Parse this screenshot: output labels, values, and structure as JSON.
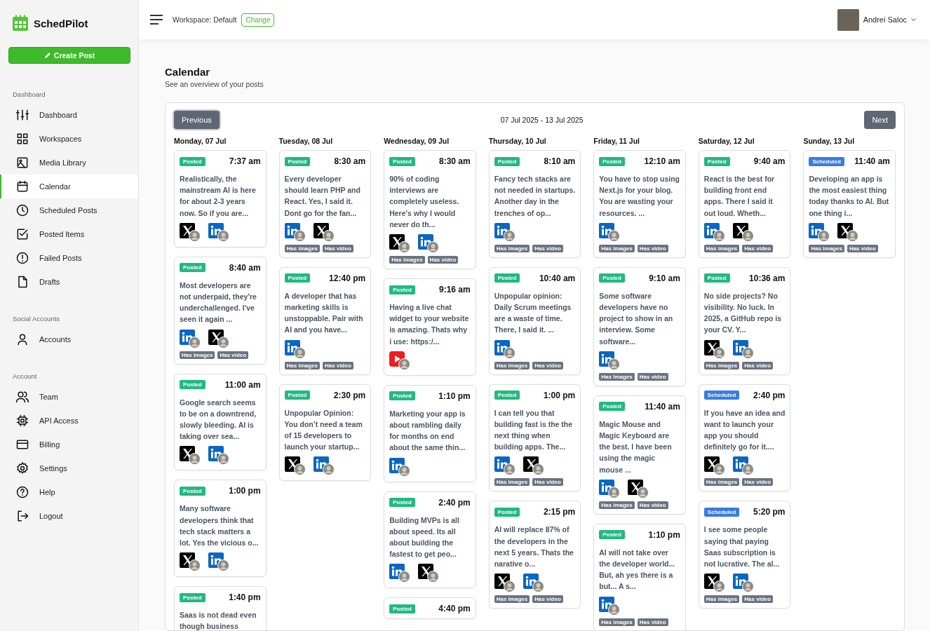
{
  "app": {
    "name": "SchedPilot"
  },
  "create_button": {
    "label": "Create Post"
  },
  "sidebar": {
    "sections": [
      {
        "title": "Dashboard",
        "items": [
          {
            "label": "Dashboard",
            "kind": "sliders",
            "selected": false
          },
          {
            "label": "Workspaces",
            "kind": "grid",
            "selected": false
          },
          {
            "label": "Media Library",
            "kind": "image",
            "selected": false
          },
          {
            "label": "Calendar",
            "kind": "calendar",
            "selected": true
          },
          {
            "label": "Scheduled Posts",
            "kind": "clock",
            "selected": false
          },
          {
            "label": "Posted Items",
            "kind": "checkbox",
            "selected": false
          },
          {
            "label": "Failed Posts",
            "kind": "alert",
            "selected": false
          },
          {
            "label": "Drafts",
            "kind": "file",
            "selected": false
          }
        ]
      },
      {
        "title": "Social Accounts",
        "items": [
          {
            "label": "Accounts",
            "kind": "user",
            "selected": false
          }
        ]
      },
      {
        "title": "Account",
        "items": [
          {
            "label": "Team",
            "kind": "users",
            "selected": false
          },
          {
            "label": "API Access",
            "kind": "chip",
            "selected": false
          },
          {
            "label": "Billing",
            "kind": "card",
            "selected": false
          },
          {
            "label": "Settings",
            "kind": "gear",
            "selected": false
          },
          {
            "label": "Help",
            "kind": "help",
            "selected": false
          },
          {
            "label": "Logout",
            "kind": "logout",
            "selected": false
          }
        ]
      }
    ]
  },
  "header": {
    "workspace": "Workspace: Default",
    "change_button": "Change",
    "user_name": "Andrei Saloc"
  },
  "page": {
    "title": "Calendar",
    "subtitle": "See an overview of your posts"
  },
  "calendar": {
    "previous": "Previous",
    "range": "07 Jul 2025 - 13 Jul 2025",
    "next": "Next",
    "days": [
      {
        "label": "Monday, 07 Jul",
        "posts": [
          {
            "status": {
              "label": "Posted",
              "kind": "posted"
            },
            "time": "7:37 am",
            "text": "Realistically, the mainstream AI is here for about 2-3 years now. So if you are...",
            "platforms": [
              {
                "kind": "x"
              },
              {
                "kind": "linkedin"
              }
            ]
          },
          {
            "status": {
              "label": "Posted",
              "kind": "posted"
            },
            "time": "8:40 am",
            "text": "Most developers are not underpaid, they're underchallenged. I've seen it again ...",
            "platforms": [
              {
                "kind": "linkedin"
              },
              {
                "kind": "x"
              }
            ],
            "tags": [
              "Has images",
              "Has video"
            ]
          },
          {
            "status": {
              "label": "Posted",
              "kind": "posted"
            },
            "time": "11:00 am",
            "text": "Google search seems to be on a downtrend, slowly bleeding. AI is taking over sea...",
            "platforms": [
              {
                "kind": "x"
              },
              {
                "kind": "linkedin"
              }
            ]
          },
          {
            "status": {
              "label": "Posted",
              "kind": "posted"
            },
            "time": "1:00 pm",
            "text": "Many software developers think that tech stack matters a lot. Yes the vicious o...",
            "platforms": [
              {
                "kind": "x"
              },
              {
                "kind": "linkedin"
              }
            ]
          },
          {
            "status": {
              "label": "Posted",
              "kind": "posted"
            },
            "time": "1:40 pm",
            "text": "Saas is not dead even though business"
          }
        ]
      },
      {
        "label": "Tuesday, 08 Jul",
        "posts": [
          {
            "status": {
              "label": "Posted",
              "kind": "posted"
            },
            "time": "8:30 am",
            "text": "Every developer should learn PHP and React. Yes, I said it. Dont go for the fan...",
            "platforms": [
              {
                "kind": "linkedin"
              },
              {
                "kind": "x"
              }
            ],
            "tags": [
              "Has images",
              "Has video"
            ]
          },
          {
            "status": {
              "label": "Posted",
              "kind": "posted"
            },
            "time": "12:40 pm",
            "text": "A developer that has marketing skills is unstoppable. Pair with AI and you have...",
            "platforms": [
              {
                "kind": "linkedin"
              }
            ],
            "tags": [
              "Has images",
              "Has video"
            ]
          },
          {
            "status": {
              "label": "Posted",
              "kind": "posted"
            },
            "time": "2:30 pm",
            "text": "Unpopular Opinion: You don’t need a team of 15 developers to launch your startup...",
            "platforms": [
              {
                "kind": "x"
              },
              {
                "kind": "linkedin"
              }
            ]
          }
        ]
      },
      {
        "label": "Wednesday, 09 Jul",
        "posts": [
          {
            "status": {
              "label": "Posted",
              "kind": "posted"
            },
            "time": "8:30 am",
            "text": "90% of coding interviews are completely useless. Here's why I would never do th...",
            "platforms": [
              {
                "kind": "x"
              },
              {
                "kind": "linkedin"
              }
            ],
            "tags": [
              "Has images",
              "Has video"
            ]
          },
          {
            "status": {
              "label": "Posted",
              "kind": "posted"
            },
            "time": "9:16 am",
            "text": "Having a live chat widget to your website is amazing. Thats why i use: https:/...",
            "platforms": [
              {
                "kind": "youtube"
              }
            ]
          },
          {
            "status": {
              "label": "Posted",
              "kind": "posted"
            },
            "time": "1:10 pm",
            "text": "Marketing your app is about rambling daily for months on end about the same thin...",
            "platforms": [
              {
                "kind": "linkedin"
              }
            ]
          },
          {
            "status": {
              "label": "Posted",
              "kind": "posted"
            },
            "time": "2:40 pm",
            "text": "Building MVPs is all about speed. Its all about building the fastest to get peo...",
            "platforms": [
              {
                "kind": "linkedin"
              },
              {
                "kind": "x"
              }
            ]
          },
          {
            "status": {
              "label": "Posted",
              "kind": "posted"
            },
            "time": "4:40 pm"
          }
        ]
      },
      {
        "label": "Thursday, 10 Jul",
        "posts": [
          {
            "status": {
              "label": "Posted",
              "kind": "posted"
            },
            "time": "8:10 am",
            "text": "Fancy tech stacks are not needed in startups. Another day in the trenches of op...",
            "platforms": [
              {
                "kind": "linkedin"
              }
            ],
            "tags": [
              "Has images",
              "Has video"
            ]
          },
          {
            "status": {
              "label": "Posted",
              "kind": "posted"
            },
            "time": "10:40 am",
            "text": "Unpopular opinion: Daily Scrum meetings are a waste of time. There, I said it. ...",
            "platforms": [
              {
                "kind": "linkedin"
              }
            ],
            "tags": [
              "Has images",
              "Has video"
            ]
          },
          {
            "status": {
              "label": "Posted",
              "kind": "posted"
            },
            "time": "1:00 pm",
            "text": "I can tell you that building fast is the the next thing when building apps. The...",
            "platforms": [
              {
                "kind": "linkedin"
              },
              {
                "kind": "x"
              }
            ],
            "tags": [
              "Has images",
              "Has video"
            ]
          },
          {
            "status": {
              "label": "Posted",
              "kind": "posted"
            },
            "time": "2:15 pm",
            "text": "AI will replace 87% of the developers in the next 5 years. Thats the narative o...",
            "platforms": [
              {
                "kind": "x"
              },
              {
                "kind": "linkedin"
              }
            ],
            "tags": [
              "Has images",
              "Has video"
            ]
          }
        ]
      },
      {
        "label": "Friday, 11 Jul",
        "posts": [
          {
            "status": {
              "label": "Posted",
              "kind": "posted"
            },
            "time": "12:10 am",
            "text": "You have to stop using Next.js for your blog. You are wasting your resources. ...",
            "platforms": [
              {
                "kind": "linkedin"
              }
            ],
            "tags": [
              "Has images",
              "Has video"
            ]
          },
          {
            "status": {
              "label": "Posted",
              "kind": "posted"
            },
            "time": "9:10 am",
            "text": "Some software developers have no project to show in an interview. Some software...",
            "platforms": [
              {
                "kind": "linkedin"
              }
            ],
            "tags": [
              "Has images",
              "Has video"
            ]
          },
          {
            "status": {
              "label": "Posted",
              "kind": "posted"
            },
            "time": "11:40 am",
            "text": "Magic Mouse and Magic Keyboard are the best. I have been using the magic mouse ...",
            "platforms": [
              {
                "kind": "linkedin"
              },
              {
                "kind": "x"
              }
            ],
            "tags": [
              "Has images",
              "Has video"
            ]
          },
          {
            "status": {
              "label": "Posted",
              "kind": "posted"
            },
            "time": "1:10 pm",
            "text": "AI will not take over the developer world... But, ah yes there is a but... A s...",
            "platforms": [
              {
                "kind": "linkedin"
              }
            ],
            "tags": [
              "Has images",
              "Has video"
            ]
          }
        ]
      },
      {
        "label": "Saturday, 12 Jul",
        "posts": [
          {
            "status": {
              "label": "Posted",
              "kind": "posted"
            },
            "time": "9:40 am",
            "text": "React is the best for building front end apps. There I said it out loud. Wheth...",
            "platforms": [
              {
                "kind": "linkedin"
              },
              {
                "kind": "x"
              }
            ],
            "tags": [
              "Has images",
              "Has video"
            ]
          },
          {
            "status": {
              "label": "Posted",
              "kind": "posted"
            },
            "time": "10:36 am",
            "text": "No side projects? No visibility. No luck. In 2025, a GitHub repo is your CV. Y...",
            "platforms": [
              {
                "kind": "x"
              },
              {
                "kind": "linkedin"
              }
            ],
            "tags": [
              "Has images",
              "Has video"
            ]
          },
          {
            "status": {
              "label": "Scheduled",
              "kind": "scheduled"
            },
            "time": "2:40 pm",
            "text": "If you have an idea and want to launch your app you should definitely go for it....",
            "platforms": [
              {
                "kind": "x"
              },
              {
                "kind": "linkedin"
              }
            ],
            "tags": [
              "Has images",
              "Has video"
            ]
          },
          {
            "status": {
              "label": "Scheduled",
              "kind": "scheduled"
            },
            "time": "5:20 pm",
            "text": "I see some people saying that paying Saas subscription is not lucrative. The al...",
            "platforms": [
              {
                "kind": "x"
              },
              {
                "kind": "linkedin"
              }
            ],
            "tags": [
              "Has images",
              "Has video"
            ]
          }
        ]
      },
      {
        "label": "Sunday, 13 Jul",
        "posts": [
          {
            "status": {
              "label": "Scheduled",
              "kind": "scheduled"
            },
            "time": "11:40 am",
            "text": "Developing an app is the most easiest thing today thanks to AI. But one thing i...",
            "platforms": [
              {
                "kind": "linkedin"
              },
              {
                "kind": "x"
              }
            ],
            "tags": [
              "Has images",
              "Has video"
            ]
          }
        ]
      }
    ]
  }
}
